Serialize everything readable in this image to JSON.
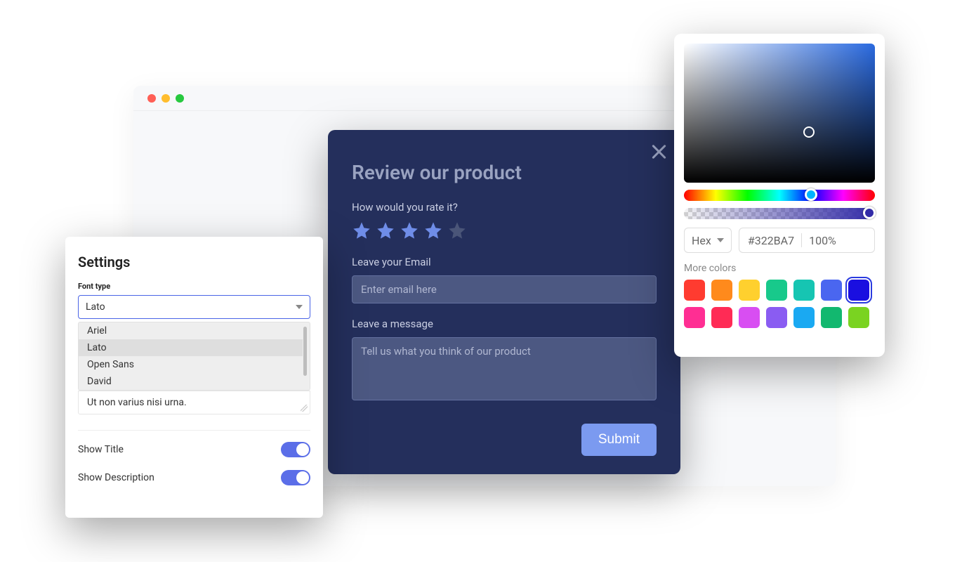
{
  "review": {
    "title": "Review our product",
    "rate_label": "How would you rate it?",
    "stars_filled": 4,
    "stars_total": 5,
    "email_label": "Leave your Email",
    "email_placeholder": "Enter email here",
    "message_label": "Leave a message",
    "message_placeholder": "Tell us what you think of our product",
    "submit_label": "Submit"
  },
  "settings": {
    "title": "Settings",
    "font_type_label": "Font type",
    "selected_font": "Lato",
    "font_options": [
      "Ariel",
      "Lato",
      "Open Sans",
      "David"
    ],
    "lorem": "Ut non varius nisi urna.",
    "show_title_label": "Show Title",
    "show_title": true,
    "show_description_label": "Show Description",
    "show_description": true
  },
  "picker": {
    "format_label": "Hex",
    "hex_value": "#322BA7",
    "opacity_value": "100%",
    "more_colors_label": "More colors",
    "swatches": [
      {
        "color": "#ff3b30",
        "selected": false
      },
      {
        "color": "#ff8a1c",
        "selected": false
      },
      {
        "color": "#ffd02e",
        "selected": false
      },
      {
        "color": "#18c98b",
        "selected": false
      },
      {
        "color": "#16c5b2",
        "selected": false
      },
      {
        "color": "#4a66f0",
        "selected": false
      },
      {
        "color": "#1a0fe0",
        "selected": true
      },
      {
        "color": "#ff2e93",
        "selected": false
      },
      {
        "color": "#ff2b55",
        "selected": false
      },
      {
        "color": "#d84ef2",
        "selected": false
      },
      {
        "color": "#8a5cf2",
        "selected": false
      },
      {
        "color": "#1aa9f2",
        "selected": false
      },
      {
        "color": "#12b86f",
        "selected": false
      },
      {
        "color": "#7ad321",
        "selected": false
      }
    ]
  }
}
